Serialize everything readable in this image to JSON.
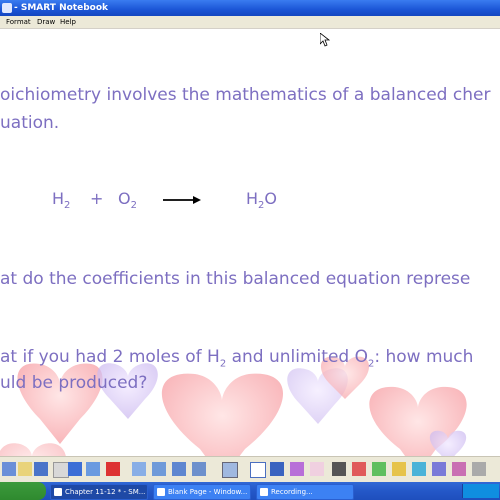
{
  "window": {
    "title": "- SMART Notebook"
  },
  "menu": {
    "items": [
      "Format",
      "Draw",
      "Help"
    ]
  },
  "slide": {
    "line1": "oichiometry involves the mathematics of a balanced cher",
    "line2": "uation.",
    "equation": {
      "reactant1": "H",
      "reactant1_sub": "2",
      "plus": "+",
      "reactant2": "O",
      "reactant2_sub": "2",
      "product": "H",
      "product_sub": "2",
      "product_tail": "O"
    },
    "question1": "at do the coefficients in this balanced equation represe",
    "question2_a": "at if you had 2 moles of H",
    "question2_sub1": "2",
    "question2_b": " and unlimited O",
    "question2_sub2": "2",
    "question2_c": ": how much",
    "question2_line2": "uld be produced?"
  },
  "taskbar": {
    "tasks": [
      {
        "label": "Chapter 11-12 * - SM...",
        "active": true
      },
      {
        "label": "Blank Page - Window...",
        "active": false
      },
      {
        "label": "Recording...",
        "active": false
      }
    ]
  },
  "colors": {
    "slide_text": "#7d6fc1",
    "titlebar": "#1b55d6",
    "taskbar": "#2458c8"
  }
}
